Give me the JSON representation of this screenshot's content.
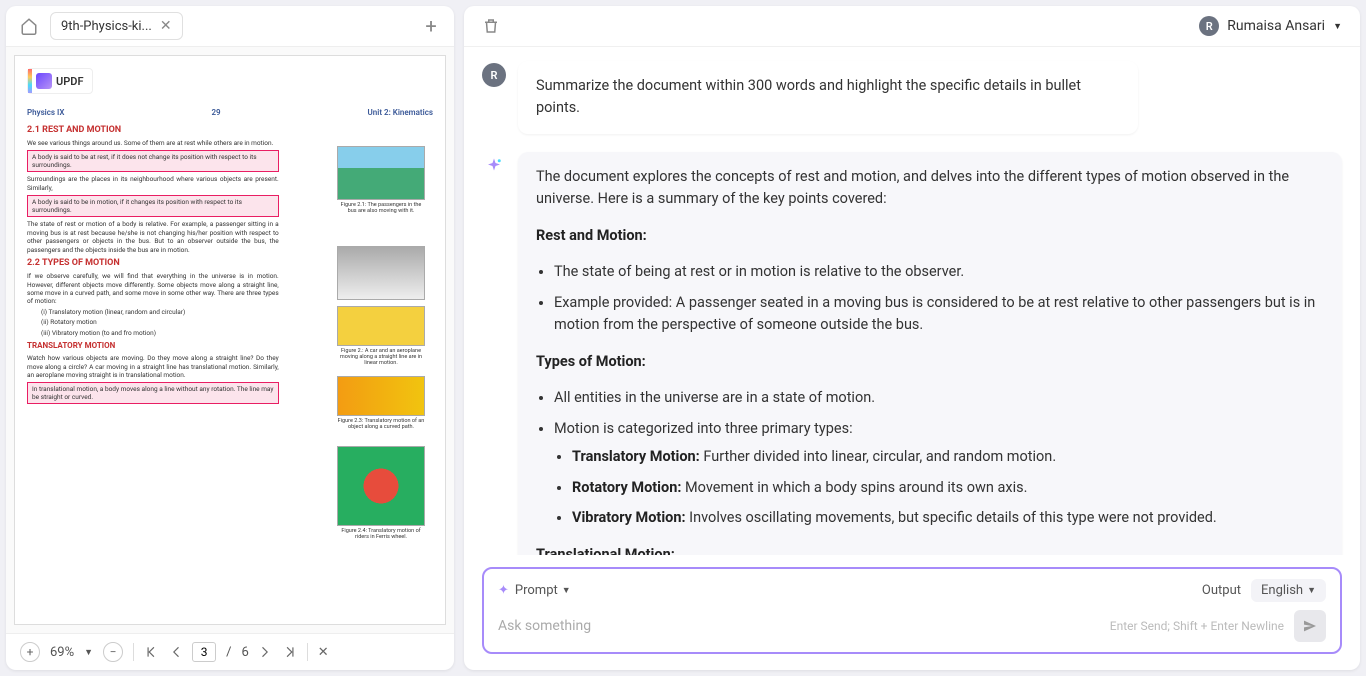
{
  "tabs": {
    "active": "9th-Physics-ki..."
  },
  "updf": {
    "brand": "UPDF"
  },
  "page": {
    "hdr_left": "Physics IX",
    "hdr_num": "29",
    "hdr_right": "Unit 2: Kinematics",
    "sec21": "2.1  REST AND MOTION",
    "intro1": "We see various things around us. Some of them are at rest while others are in motion.",
    "box1": "A body is said to be at rest, if it does not change its position with respect to its surroundings.",
    "surr": "Surroundings are the places in its neighbourhood where various objects are present. Similarly,",
    "box2": "A body is said to be in motion, if it changes its position with respect to its surroundings.",
    "fig21": "Figure 2.1: The passengers in the bus are also moving with it.",
    "state": "The state of rest or motion of a body is relative. For example, a passenger sitting in a moving bus is at rest because he/she is not changing his/her position with respect to other passengers or objects in the bus. But to an observer outside the bus, the passengers and the objects inside the bus are in motion.",
    "sec22": "2.2  TYPES OF MOTION",
    "types_intro": "If we observe carefully, we will find that everything in the universe is in motion. However, different objects move differently. Some objects move along a straight line, some move in a curved path, and some move in some other way. There are three types of motion:",
    "t1": "(i)   Translatory motion  (linear, random and circular)",
    "t2": "(ii)  Rotatory motion",
    "t3": "(iii) Vibratory motion   (to and fro motion)",
    "fig22": "Figure 2.: A car and an aeroplane moving along a straight line are in linear motion.",
    "fig23": "Figure 2.3: Translatory motion of an object along a curved path.",
    "trans_hdr": "TRANSLATORY MOTION",
    "trans_body": "Watch how various objects are moving. Do they move along a straight line? Do they move along a circle? A car moving in a straight line has translational motion. Similarly, an aeroplane moving straight is in translational motion.",
    "box3": "In translational motion, a body moves along a line without any rotation. The line may be straight or curved.",
    "fig24": "Figure 2.4: Translatory motion of riders in Ferris wheel."
  },
  "toolbar": {
    "zoom": "69%",
    "page": "3",
    "total": "6"
  },
  "user": {
    "initial": "R",
    "name": "Rumaisa Ansari"
  },
  "chat": {
    "user_msg": "Summarize the document within 300 words and highlight the specific details in bullet points.",
    "ai": {
      "p1": "The document explores the concepts of rest and motion, and delves into the different types of motion observed in the universe. Here is a summary of the key points covered:",
      "h1": "Rest and Motion:",
      "b1": "The state of being at rest or in motion is relative to the observer.",
      "b2": "Example provided: A passenger seated in a moving bus is considered to be at rest relative to other passengers but is in motion from the perspective of someone outside the bus.",
      "h2": "Types of Motion:",
      "b3": "All entities in the universe are in a state of motion.",
      "b4": "Motion is categorized into three primary types:",
      "b4a_label": "Translatory Motion:",
      "b4a_text": " Further divided into linear, circular, and random motion.",
      "b4b_label": "Rotatory Motion:",
      "b4b_text": " Movement in which a body spins around its own axis.",
      "b4c_label": "Vibratory Motion:",
      "b4c_text": " Involves oscillating movements, but specific details of this type were not provided.",
      "h3": "Translational Motion:"
    }
  },
  "input": {
    "prompt_label": "Prompt",
    "output_label": "Output",
    "lang": "English",
    "placeholder": "Ask something",
    "hint": "Enter Send; Shift + Enter Newline"
  }
}
